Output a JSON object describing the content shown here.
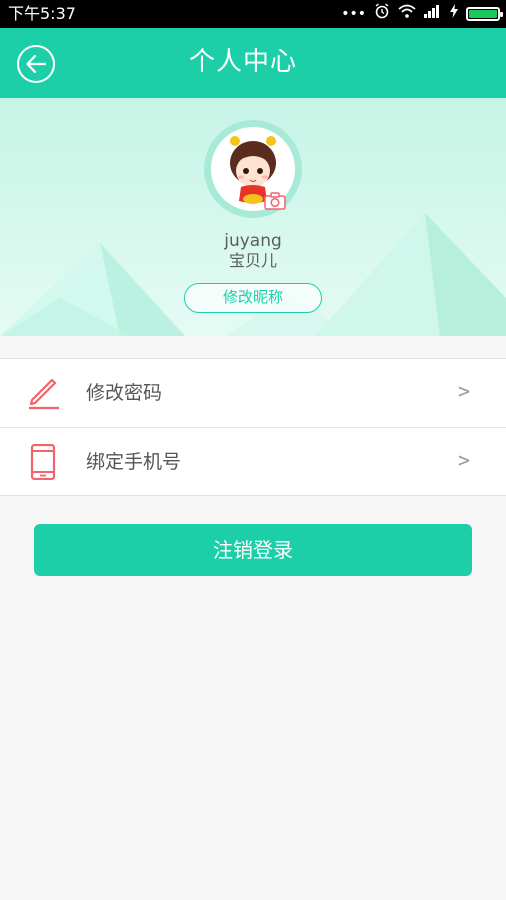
{
  "status_bar": {
    "time": "下午5:37",
    "icons": [
      "more-icon",
      "alarm-icon",
      "wifi-icon",
      "signal-icon",
      "charging-icon",
      "battery-icon"
    ],
    "battery_level": 1.0
  },
  "header": {
    "title": "个人中心",
    "back_icon": "back-arrow-icon",
    "color": "#1ccfa9"
  },
  "profile": {
    "username": "juyang",
    "nickname": "宝贝儿",
    "edit_nickname_label": "修改昵称",
    "avatar_icon": "cartoon-girl-avatar",
    "camera_icon": "camera-icon"
  },
  "menu": {
    "items": [
      {
        "label": "修改密码",
        "icon": "pencil-icon",
        "arrow": ">"
      },
      {
        "label": "绑定手机号",
        "icon": "phone-icon",
        "arrow": ">"
      }
    ]
  },
  "logout_label": "注销登录",
  "colors": {
    "accent": "#1ccfa9",
    "icon_red": "#f0656b",
    "text": "#555555"
  }
}
